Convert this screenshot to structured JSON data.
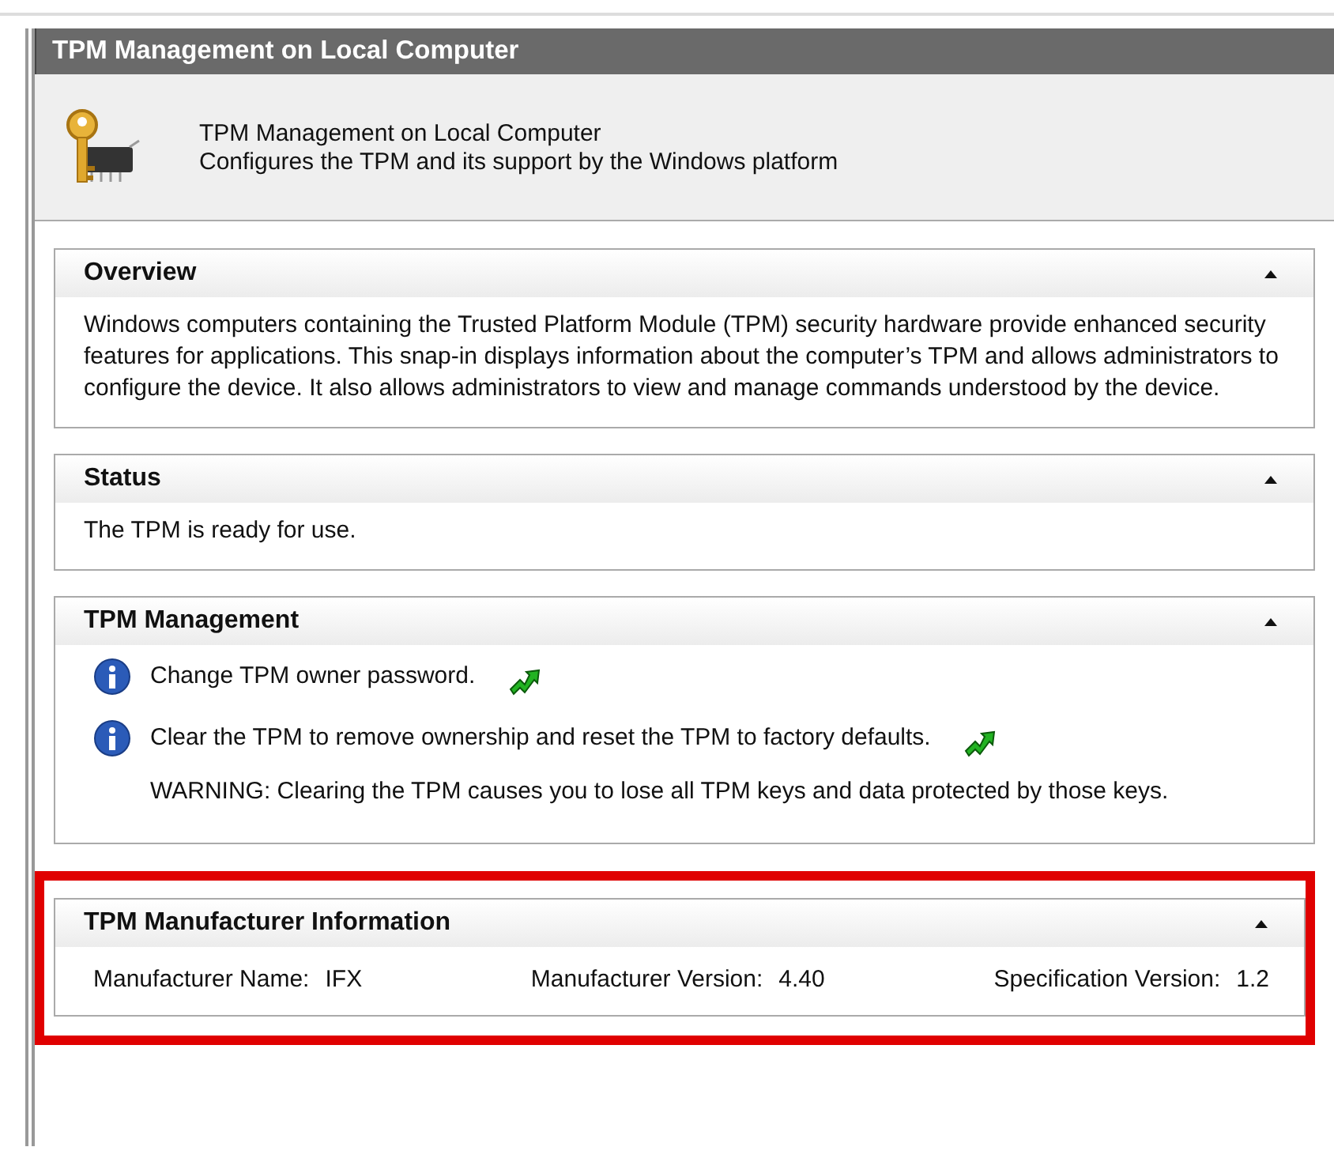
{
  "window": {
    "title": "TPM Management on Local Computer"
  },
  "header": {
    "title": "TPM Management on Local Computer",
    "subtitle": "Configures the TPM and its support by the Windows platform"
  },
  "sections": [
    {
      "kind": "text",
      "title": "Overview",
      "expanded": true,
      "highlighted": false,
      "text": "Windows computers containing the Trusted Platform Module (TPM) security hardware provide enhanced security features for applications. This snap-in displays information about the computer’s TPM and allows administrators to configure the device. It also allows administrators to view and manage commands understood by the device."
    },
    {
      "kind": "text",
      "title": "Status",
      "expanded": true,
      "highlighted": false,
      "text": "The TPM is ready for use."
    },
    {
      "kind": "actions",
      "title": "TPM Management",
      "expanded": true,
      "highlighted": false,
      "items": [
        {
          "kind": "action",
          "text": "Change TPM owner password."
        },
        {
          "kind": "action",
          "text": "Clear the TPM to remove ownership and reset the TPM to factory defaults."
        },
        {
          "kind": "note",
          "text": "WARNING: Clearing the TPM causes you to lose all TPM keys and data protected by those keys."
        }
      ]
    },
    {
      "kind": "fields",
      "title": "TPM Manufacturer Information",
      "expanded": true,
      "highlighted": true,
      "fields": [
        {
          "label": "Manufacturer Name:",
          "value": "IFX"
        },
        {
          "label": "Manufacturer Version:",
          "value": "4.40"
        },
        {
          "label": "Specification Version:",
          "value": "1.2"
        }
      ]
    }
  ]
}
